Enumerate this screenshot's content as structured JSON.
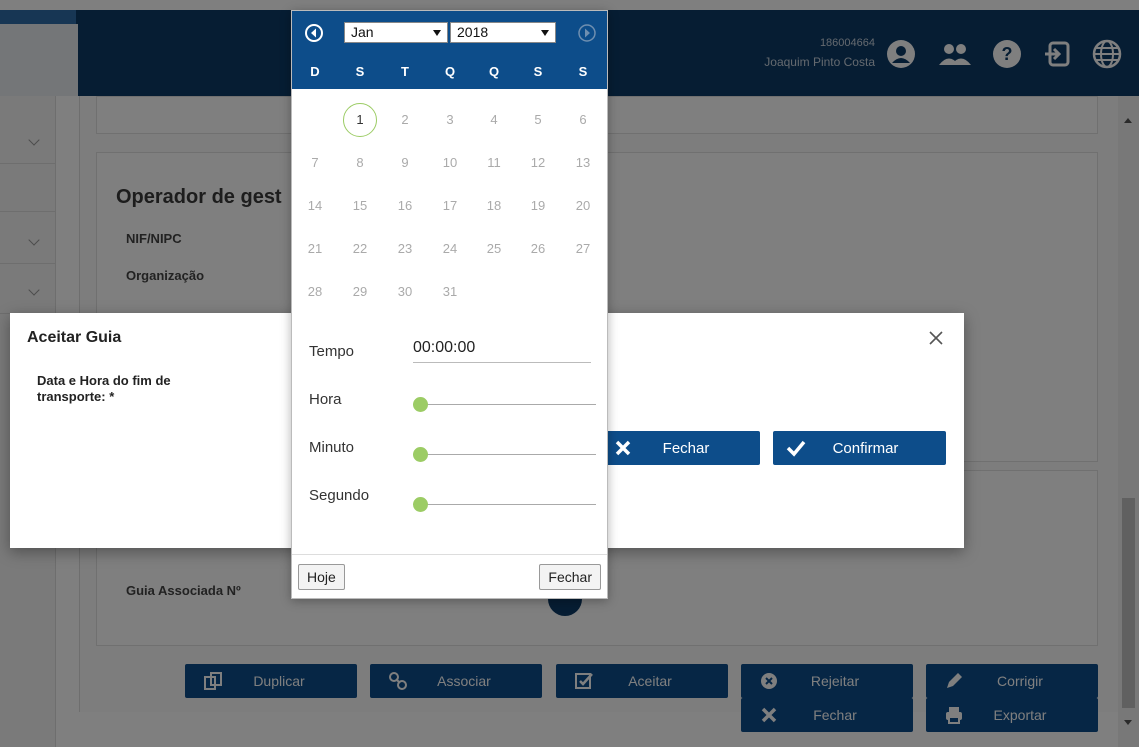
{
  "header": {
    "user_id": "186004664",
    "user_name": "Joaquim Pinto Costa",
    "icons": [
      "user-circle-icon",
      "users-icon",
      "help-circle-icon",
      "sign-in-icon",
      "globe-icon"
    ]
  },
  "page": {
    "section_title": "Operador de gest",
    "fields": {
      "nif": "NIF/NIPC",
      "org": "Organização",
      "guia": "Guia Associada Nº"
    },
    "actions": {
      "duplicar": "Duplicar",
      "associar": "Associar",
      "aceitar": "Aceitar",
      "rejeitar": "Rejeitar",
      "corrigir": "Corrigir",
      "fechar": "Fechar",
      "exportar": "Exportar"
    }
  },
  "modal": {
    "title": "Aceitar Guia",
    "field_label": "Data e Hora do fim de transporte: *",
    "close_label": "Fechar",
    "confirm_label": "Confirmar"
  },
  "picker": {
    "month": "Jan",
    "year": "2018",
    "weekdays": [
      "D",
      "S",
      "T",
      "Q",
      "Q",
      "S",
      "S"
    ],
    "weeks": [
      [
        "",
        "1",
        "2",
        "3",
        "4",
        "5",
        "6"
      ],
      [
        "7",
        "8",
        "9",
        "10",
        "11",
        "12",
        "13"
      ],
      [
        "14",
        "15",
        "16",
        "17",
        "18",
        "19",
        "20"
      ],
      [
        "21",
        "22",
        "23",
        "24",
        "25",
        "26",
        "27"
      ],
      [
        "28",
        "29",
        "30",
        "31",
        "",
        "",
        ""
      ]
    ],
    "selected_day": "1",
    "time_label": "Tempo",
    "time_value": "00:00:00",
    "hour_label": "Hora",
    "minute_label": "Minuto",
    "second_label": "Segundo",
    "hour_value": 0,
    "minute_value": 0,
    "second_value": 0,
    "today_label": "Hoje",
    "close_label": "Fechar"
  },
  "colors": {
    "primary": "#0d4d8a",
    "accent_green": "#9ccc65"
  }
}
